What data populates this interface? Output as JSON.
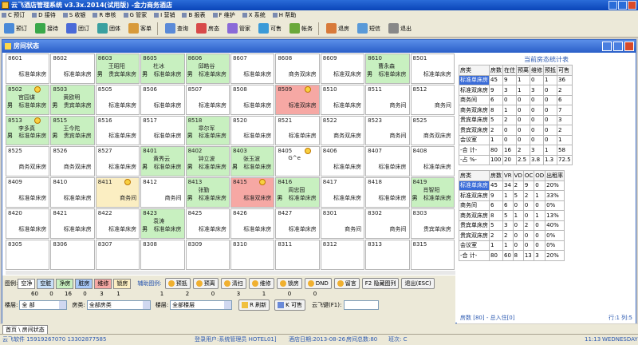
{
  "app": {
    "title": "云飞酒店管理系统 v3.3x.2014(试用版) -金力商务酒店"
  },
  "menu": [
    {
      "label": "C 预订",
      "icon": "book-icon"
    },
    {
      "label": "D 接待",
      "icon": "reception-icon"
    },
    {
      "label": "S 收银",
      "icon": "cashier-icon"
    },
    {
      "label": "R 审核",
      "icon": "audit-icon"
    },
    {
      "label": "G 管家",
      "icon": "housekeeping-icon"
    },
    {
      "label": "I 营销",
      "icon": "marketing-icon"
    },
    {
      "label": "B 报表",
      "icon": "report-icon"
    },
    {
      "label": "F 维护",
      "icon": "maintenance-icon"
    },
    {
      "label": "X 系统",
      "icon": "system-icon"
    },
    {
      "label": "H 帮助",
      "icon": "help-icon"
    }
  ],
  "toolbar": [
    {
      "label": "预订",
      "color": "#4a8ad8"
    },
    {
      "label": "接待",
      "color": "#3aa84a"
    },
    {
      "label": "团订",
      "color": "#4a6ad8"
    },
    {
      "label": "团体",
      "color": "#3aa0a0"
    },
    {
      "label": "客单",
      "color": "#d89a3a"
    },
    {
      "label": "查询",
      "color": "#5a8ad8"
    },
    {
      "label": "房态",
      "color": "#d84a4a"
    },
    {
      "label": "管家",
      "color": "#8a6ad8"
    },
    {
      "label": "可售",
      "color": "#3a9ad8"
    },
    {
      "label": "帐务",
      "color": "#6aa83a"
    },
    {
      "label": "退房",
      "color": "#d87a3a"
    },
    {
      "label": "短信",
      "color": "#5a9ad8"
    },
    {
      "label": "退出",
      "color": "#888888"
    }
  ],
  "window": {
    "title": "房间状态"
  },
  "rooms": [
    {
      "num": "8601",
      "type": "标准单床房",
      "guest": "",
      "status": "vacant"
    },
    {
      "num": "8602",
      "type": "标准单床房",
      "guest": "",
      "status": "vacant"
    },
    {
      "num": "8603",
      "type": "贵宾单床房",
      "guest": "王昭阳",
      "status": "occupied",
      "sex": "男"
    },
    {
      "num": "8605",
      "type": "标准单床房",
      "guest": "杜冰",
      "status": "occupied",
      "sex": "男"
    },
    {
      "num": "8606",
      "type": "标准单床房",
      "guest": "邱皓谷",
      "status": "occupied",
      "sex": "男"
    },
    {
      "num": "8607",
      "type": "标准单床房",
      "guest": "",
      "status": "vacant"
    },
    {
      "num": "8608",
      "type": "商务双床房",
      "guest": "",
      "status": "vacant"
    },
    {
      "num": "8609",
      "type": "标准双床房",
      "guest": "",
      "status": "vacant"
    },
    {
      "num": "8610",
      "type": "标准单床房",
      "guest": "曹永森",
      "status": "occupied",
      "sex": "男"
    },
    {
      "num": "8501",
      "type": "标准单床房",
      "guest": "",
      "status": "vacant"
    },
    {
      "num": "8502",
      "type": "标准单床房",
      "guest": "官园谋",
      "status": "occupied",
      "sex": "男",
      "icon": true
    },
    {
      "num": "8503",
      "type": "贵宾单床房",
      "guest": "黄欧明",
      "status": "occupied",
      "sex": "男"
    },
    {
      "num": "8505",
      "type": "标准单床房",
      "guest": "",
      "status": "vacant"
    },
    {
      "num": "8506",
      "type": "标准单床房",
      "guest": "",
      "status": "vacant"
    },
    {
      "num": "8507",
      "type": "标准单床房",
      "guest": "",
      "status": "vacant"
    },
    {
      "num": "8508",
      "type": "标准单床房",
      "guest": "",
      "status": "vacant"
    },
    {
      "num": "8509",
      "type": "标准双床房",
      "guest": "",
      "status": "dirty",
      "icon": true
    },
    {
      "num": "8510",
      "type": "标准单床房",
      "guest": "",
      "status": "vacant"
    },
    {
      "num": "8511",
      "type": "商务间",
      "guest": "",
      "status": "vacant"
    },
    {
      "num": "8512",
      "type": "商务间",
      "guest": "",
      "status": "vacant"
    },
    {
      "num": "8513",
      "type": "标准单床房",
      "guest": "李多真",
      "status": "occupied",
      "sex": "男",
      "icon": true
    },
    {
      "num": "8515",
      "type": "贵宾单床房",
      "guest": "王今陀",
      "status": "occupied",
      "sex": "男"
    },
    {
      "num": "8516",
      "type": "标准单床房",
      "guest": "",
      "status": "vacant"
    },
    {
      "num": "8517",
      "type": "标准单床房",
      "guest": "",
      "status": "vacant"
    },
    {
      "num": "8518",
      "type": "标准单床房",
      "guest": "章尔军",
      "status": "occupied",
      "sex": "男"
    },
    {
      "num": "8520",
      "type": "标准单床房",
      "guest": "",
      "status": "vacant"
    },
    {
      "num": "8521",
      "type": "标准单床房",
      "guest": "",
      "status": "vacant"
    },
    {
      "num": "8522",
      "type": "商务双床房",
      "guest": "",
      "status": "vacant"
    },
    {
      "num": "8523",
      "type": "商务间",
      "guest": "",
      "status": "vacant"
    },
    {
      "num": "8525",
      "type": "商务双床房",
      "guest": "",
      "status": "vacant"
    },
    {
      "num": "8525",
      "type": "商务双床房",
      "guest": "",
      "status": "vacant"
    },
    {
      "num": "8526",
      "type": "商务双床房",
      "guest": "",
      "status": "vacant"
    },
    {
      "num": "8527",
      "type": "标准单床房",
      "guest": "",
      "status": "vacant"
    },
    {
      "num": "8401",
      "type": "标准单床房",
      "guest": "黄秀云",
      "status": "occupied",
      "sex": "男"
    },
    {
      "num": "8402",
      "type": "标准单床房",
      "guest": "钟立波",
      "status": "occupied",
      "sex": "男"
    },
    {
      "num": "8403",
      "type": "标准单床房",
      "guest": "张玉波",
      "status": "occupied",
      "sex": "男"
    },
    {
      "num": "8405",
      "type": "",
      "guest": "G^e",
      "status": "vacant",
      "icon": true
    },
    {
      "num": "8406",
      "type": "标准单床房",
      "guest": "",
      "status": "vacant"
    },
    {
      "num": "8407",
      "type": "标准单床房",
      "guest": "",
      "status": "vacant"
    },
    {
      "num": "8408",
      "type": "标准单床房",
      "guest": "",
      "status": "vacant"
    },
    {
      "num": "8409",
      "type": "标准单床房",
      "guest": "",
      "status": "vacant"
    },
    {
      "num": "8410",
      "type": "标准单床房",
      "guest": "",
      "status": "vacant"
    },
    {
      "num": "8411",
      "type": "商务间",
      "guest": "",
      "status": "booked",
      "icon": true
    },
    {
      "num": "8412",
      "type": "商务间",
      "guest": "",
      "status": "vacant"
    },
    {
      "num": "8413",
      "type": "标准单床房",
      "guest": "张勤",
      "status": "occupied",
      "sex": "男"
    },
    {
      "num": "8415",
      "type": "标准双床房",
      "guest": "",
      "status": "dirty",
      "icon": true
    },
    {
      "num": "8416",
      "type": "标准单床房",
      "guest": "周忠园",
      "status": "occupied",
      "sex": "男"
    },
    {
      "num": "8417",
      "type": "标准单床房",
      "guest": "",
      "status": "vacant"
    },
    {
      "num": "8418",
      "type": "标准单床房",
      "guest": "",
      "status": "vacant"
    },
    {
      "num": "8419",
      "type": "标准单床房",
      "guest": "肖智阳",
      "status": "occupied",
      "sex": "男"
    },
    {
      "num": "8420",
      "type": "标准单床房",
      "guest": "",
      "status": "vacant"
    },
    {
      "num": "8421",
      "type": "标准单床房",
      "guest": "",
      "status": "vacant"
    },
    {
      "num": "8422",
      "type": "标准单床房",
      "guest": "",
      "status": "vacant"
    },
    {
      "num": "8423",
      "type": "标准单床房",
      "guest": "袁涛",
      "status": "occupied",
      "sex": "男"
    },
    {
      "num": "8425",
      "type": "标准单床房",
      "guest": "",
      "status": "vacant"
    },
    {
      "num": "8426",
      "type": "标准单床房",
      "guest": "",
      "status": "vacant"
    },
    {
      "num": "8427",
      "type": "标准单床房",
      "guest": "",
      "status": "vacant"
    },
    {
      "num": "8301",
      "type": "商务间",
      "guest": "",
      "status": "vacant"
    },
    {
      "num": "8302",
      "type": "商务间",
      "guest": "",
      "status": "vacant"
    },
    {
      "num": "8303",
      "type": "贵宾单床房",
      "guest": "",
      "status": "vacant"
    },
    {
      "num": "8305",
      "type": "",
      "guest": "",
      "status": "vacant"
    },
    {
      "num": "8306",
      "type": "",
      "guest": "",
      "status": "vacant"
    },
    {
      "num": "8307",
      "type": "",
      "guest": "",
      "status": "vacant"
    },
    {
      "num": "8308",
      "type": "",
      "guest": "",
      "status": "vacant"
    },
    {
      "num": "8309",
      "type": "",
      "guest": "",
      "status": "vacant"
    },
    {
      "num": "8310",
      "type": "",
      "guest": "",
      "status": "vacant"
    },
    {
      "num": "8311",
      "type": "",
      "guest": "",
      "status": "vacant"
    },
    {
      "num": "8312",
      "type": "",
      "guest": "",
      "status": "vacant"
    },
    {
      "num": "8313",
      "type": "",
      "guest": "",
      "status": "vacant"
    },
    {
      "num": "8315",
      "type": "",
      "guest": "",
      "status": "vacant"
    }
  ],
  "stats": {
    "title": "当前房态统计表",
    "headers": [
      "房类",
      "房数",
      "在住",
      "预离",
      "维修",
      "预抵",
      "可售"
    ],
    "rows": [
      [
        "标准单床房",
        "45",
        "9",
        "1",
        "0",
        "1",
        "36"
      ],
      [
        "标准双床房",
        "9",
        "3",
        "1",
        "3",
        "0",
        "2"
      ],
      [
        "商务间",
        "6",
        "0",
        "0",
        "0",
        "0",
        "6"
      ],
      [
        "商务双床房",
        "8",
        "1",
        "0",
        "0",
        "0",
        "7"
      ],
      [
        "贵宾单床房",
        "5",
        "2",
        "0",
        "0",
        "0",
        "3"
      ],
      [
        "贵宾双床房",
        "2",
        "0",
        "0",
        "0",
        "0",
        "2"
      ],
      [
        "会议室",
        "1",
        "0",
        "0",
        "0",
        "0",
        "1"
      ],
      [
        "-合 计-",
        "80",
        "16",
        "2",
        "3",
        "1",
        "58"
      ],
      [
        "-占 %-",
        "100",
        "20",
        "2.5",
        "3.8",
        "1.3",
        "72.5"
      ]
    ],
    "headers2": [
      "房类",
      "房数",
      "VR",
      "VD",
      "OC",
      "OD",
      "出租率"
    ],
    "rows2": [
      [
        "标准单床房",
        "45",
        "34",
        "2",
        "9",
        "0",
        "20%"
      ],
      [
        "标准双床房",
        "9",
        "1",
        "5",
        "2",
        "1",
        "33%"
      ],
      [
        "商务间",
        "6",
        "6",
        "0",
        "0",
        "0",
        "0%"
      ],
      [
        "商务双床房",
        "8",
        "5",
        "1",
        "0",
        "1",
        "13%"
      ],
      [
        "贵宾单床房",
        "5",
        "3",
        "0",
        "2",
        "0",
        "40%"
      ],
      [
        "贵宾双床房",
        "2",
        "2",
        "0",
        "0",
        "0",
        "0%"
      ],
      [
        "会议室",
        "1",
        "1",
        "0",
        "0",
        "0",
        "0%"
      ],
      [
        "-合 计-",
        "80",
        "60",
        "8",
        "13",
        "3",
        "20%"
      ]
    ],
    "footer_left": "房数 [80] - 总入住[0]",
    "footer_right": "行:1 列:5"
  },
  "legend": {
    "label": "图例:",
    "items": [
      {
        "label": "空净",
        "color": "#ffffff"
      },
      {
        "label": "空脏",
        "color": "#c8e0f8"
      },
      {
        "label": "净房",
        "color": "#c8f0c0"
      },
      {
        "label": "脏房",
        "color": "#a8c8f8"
      },
      {
        "label": "维修",
        "color": "#f6a8a4"
      },
      {
        "label": "锁房",
        "color": "#fbeec2"
      }
    ],
    "counts": [
      "60",
      "0",
      "16",
      "0",
      "3",
      "1"
    ],
    "aux_label": "辅助图例:",
    "aux": [
      {
        "label": "预抵",
        "count": "1"
      },
      {
        "label": "预离",
        "count": "2"
      },
      {
        "label": "清扫",
        "count": "0"
      },
      {
        "label": "维修",
        "count": "3"
      },
      {
        "label": "锁房",
        "count": "1"
      },
      {
        "label": "DND",
        "count": "0"
      },
      {
        "label": "留言",
        "count": "0"
      }
    ],
    "hide_btn": "F2 隐藏图列",
    "exit_btn": "退出(ESC)"
  },
  "filters": {
    "floor_label": "楼层:",
    "floor_value": "全  部",
    "type_label": "房类:",
    "type_value": "全部房类",
    "building_label": "楼层:",
    "building_value": "全部楼层",
    "refresh": "R 刷新",
    "available": "K 可售",
    "key_label": "云飞键(F1):"
  },
  "tab": {
    "label": "首页 \\ 房间状态"
  },
  "status": {
    "company": "云飞软件 15919267070 13302877585",
    "user": "登录用户:系统管理员 HOTEL01]",
    "date": "酒店日期:2013-08-26",
    "rooms": "房间总数:80",
    "shift": "班次: C",
    "time": "11:13",
    "weekday": "WEDNESDAY"
  }
}
